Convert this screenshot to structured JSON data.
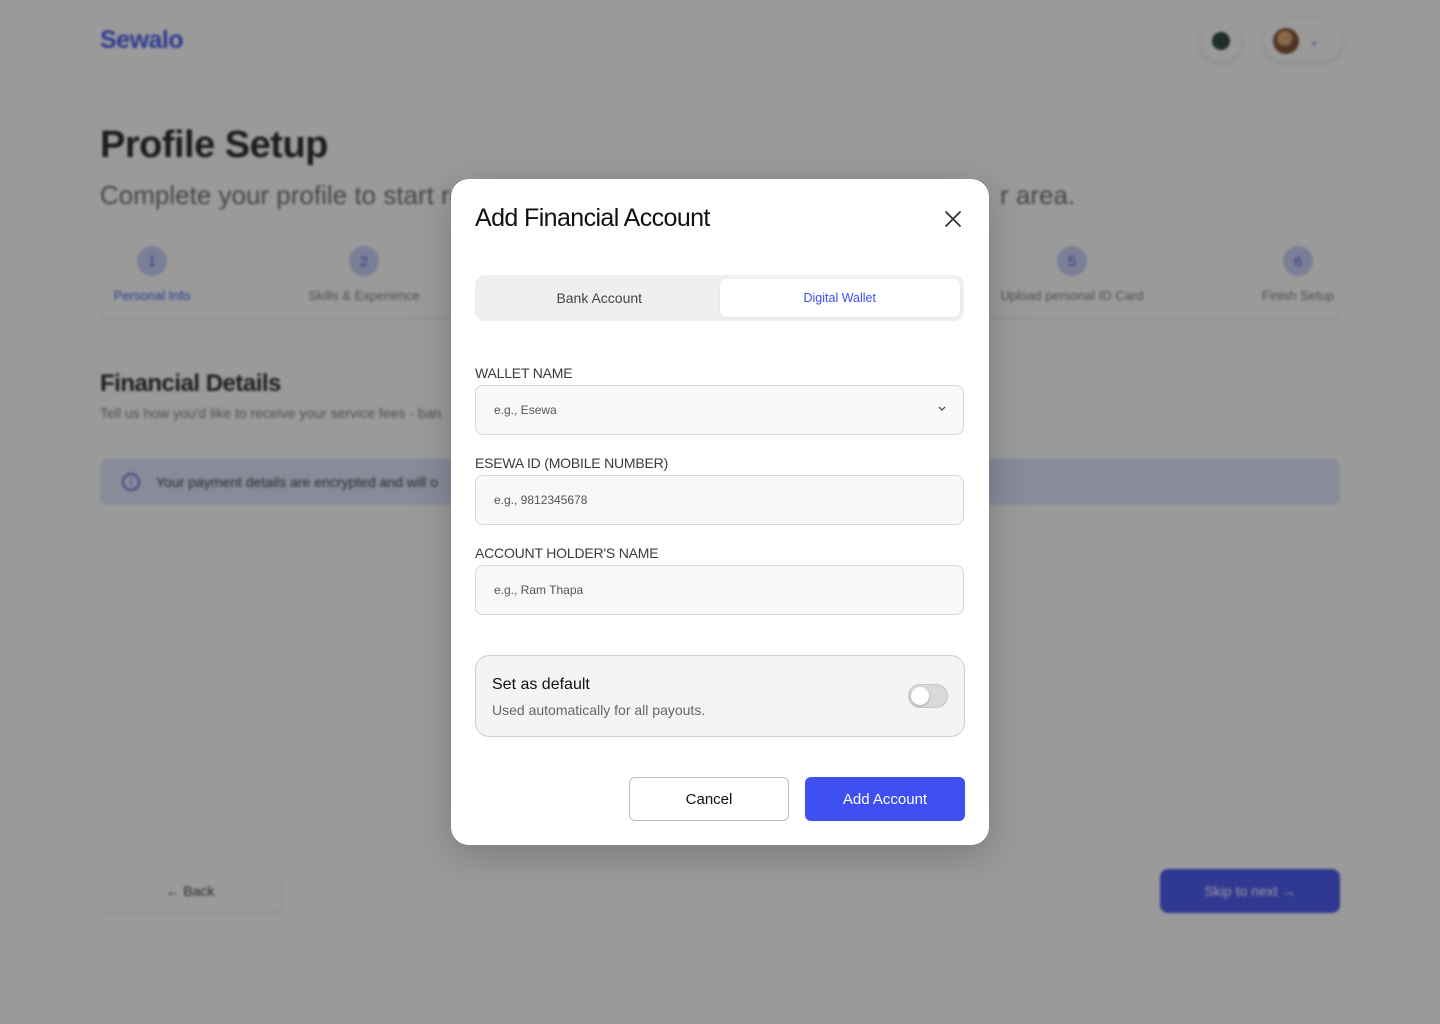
{
  "app": {
    "logo": "Sewalo"
  },
  "header": {
    "notification_icon": "chat-bubble-icon",
    "avatar_icon": "user-avatar",
    "chevron_icon": "chevron-down-icon"
  },
  "page": {
    "title": "Profile Setup",
    "subtitle_visible": "Complete your profile to start re",
    "subtitle_tail": "r area.",
    "steps": [
      {
        "number": "1",
        "label": "Personal Info",
        "active": true
      },
      {
        "number": "2",
        "label": "Skills & Experience",
        "active": false
      },
      {
        "number": "5",
        "label": "Upload personal ID Card",
        "active": false
      },
      {
        "number": "6",
        "label": "Finish Setup",
        "active": false
      }
    ],
    "section_title": "Financial Details",
    "section_subtitle": "Tell us how you'd like to receive your service fees - ban",
    "info_banner": "Your payment details are encrypted and will o",
    "back_label": "← Back",
    "skip_label": "Skip to next →"
  },
  "modal": {
    "title": "Add Financial Account",
    "tabs": [
      {
        "label": "Bank Account",
        "active": false
      },
      {
        "label": "Digital Wallet",
        "active": true
      }
    ],
    "fields": {
      "wallet_name": {
        "label": "WALLET NAME",
        "placeholder": "e.g., Esewa",
        "value": ""
      },
      "esewa_id": {
        "label": "ESEWA ID (MOBILE NUMBER)",
        "placeholder": "e.g., 9812345678",
        "value": ""
      },
      "holder_name": {
        "label": "ACCOUNT HOLDER'S NAME",
        "placeholder": "e.g., Ram Thapa",
        "value": ""
      }
    },
    "default_toggle": {
      "title": "Set as default",
      "subtitle": "Used automatically for all payouts.",
      "on": false
    },
    "cancel_label": "Cancel",
    "submit_label": "Add Account"
  },
  "colors": {
    "accent": "#3f4ff0",
    "overlay": "rgba(30,30,30,0.45)"
  }
}
